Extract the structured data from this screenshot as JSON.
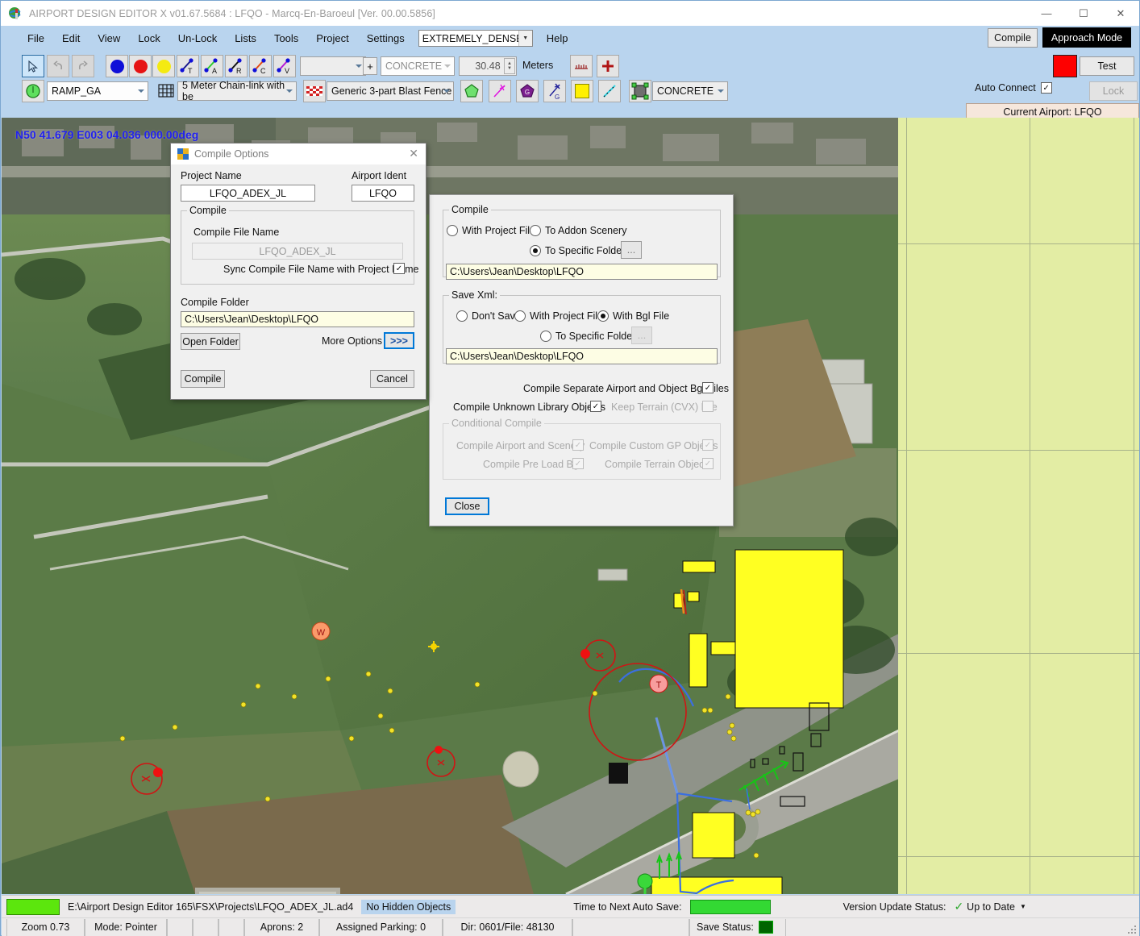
{
  "window": {
    "title": "AIRPORT DESIGN EDITOR X  v01.67.5684 : LFQO - Marcq-En-Baroeul [Ver. 00.00.5856]",
    "minimize": "—",
    "maximize": "☐",
    "close": "✕"
  },
  "menu": {
    "items": [
      "File",
      "Edit",
      "View",
      "Lock",
      "Un-Lock",
      "Lists",
      "Tools",
      "Project",
      "Settings"
    ],
    "density_value": "EXTREMELY_DENSE",
    "help": "Help",
    "compile_button": "Compile",
    "approach_mode_button": "Approach Mode"
  },
  "toolbar": {
    "pointer_icon": "pointer-icon",
    "undo_icon": "undo-icon",
    "redo_icon": "redo-icon",
    "blue_dot_icon": "blue-node-icon",
    "red_dot_icon": "red-node-icon",
    "yellow_dot_icon": "yellow-node-icon",
    "link_t_icon": "link-taxiway-icon",
    "link_a_icon": "link-apron-icon",
    "link_r_icon": "link-runway-icon",
    "link_c_icon": "link-closed-icon",
    "link_v_icon": "link-vehicle-icon",
    "empty_combo_value": "",
    "plus_label": "+",
    "surface_combo_value": "CONCRETE",
    "width_value": "30.48",
    "units_label": "Meters",
    "ruler_icon": "ruler-icon",
    "crosshair_icon": "red-cross-icon",
    "parking_icon": "parking-circle-icon",
    "parking_combo_value": "RAMP_GA",
    "fence_grid_icon": "fence-grid-icon",
    "fence_combo_value": "5 Meter Chain-link with be",
    "blast_icon": "blast-fence-icon",
    "blast_combo_value": "Generic 3-part Blast Fence",
    "polygon_icon": "green-polygon-icon",
    "magenta_line_icon": "magenta-vector-icon",
    "gp_icon": "purple-gp-icon",
    "g_vector_icon": "g-vector-icon",
    "yellow_square_icon": "yellow-square-icon",
    "dashed_line_icon": "dashed-line-icon",
    "select_box_icon": "select-box-icon",
    "material_combo_value": "CONCRETE",
    "auto_connect_label": "Auto Connect",
    "auto_connect_checked": true,
    "color_swatch": "#fe0000",
    "test_button": "Test",
    "lock_button": "Lock",
    "current_airport": "Current Airport: LFQO"
  },
  "map": {
    "coordinates": "N50 41.679   E003 04.036 000.00deg",
    "wind_marker": "W",
    "tower_marker": "T",
    "grid_panel_color": "#e3eda4"
  },
  "compile_dialog": {
    "title": "Compile Options",
    "close_icon": "close-icon",
    "project_name_label": "Project Name",
    "project_name_value": "LFQO_ADEX_JL",
    "airport_ident_label": "Airport Ident",
    "airport_ident_value": "LFQO",
    "compile_group_title": "Compile",
    "compile_file_name_label": "Compile File Name",
    "compile_file_name_value": "LFQO_ADEX_JL",
    "sync_label": "Sync Compile File Name with Project Name",
    "sync_checked": true,
    "compile_folder_label": "Compile Folder",
    "compile_folder_value": "C:\\Users\\Jean\\Desktop\\LFQO",
    "open_folder_button": "Open Folder",
    "more_options_label": "More Options",
    "more_options_button": ">>>",
    "compile_button": "Compile",
    "cancel_button": "Cancel"
  },
  "options_panel": {
    "compile_group_title": "Compile",
    "compile_options": [
      {
        "label": "With Project File",
        "selected": false
      },
      {
        "label": "To Addon Scenery",
        "selected": false
      },
      {
        "label": "To Specific Folder",
        "selected": true
      }
    ],
    "compile_browse_button": "...",
    "compile_path_value": "C:\\Users\\Jean\\Desktop\\LFQO",
    "savexml_group_title": "Save Xml:",
    "savexml_options": [
      {
        "label": "Don't Save",
        "selected": false
      },
      {
        "label": "With Project File",
        "selected": false
      },
      {
        "label": "With Bgl File",
        "selected": true
      },
      {
        "label": "To Specific Folder",
        "selected": false
      }
    ],
    "savexml_browse_button": "...",
    "savexml_path_value": "C:\\Users\\Jean\\Desktop\\LFQO",
    "separate_bgl_label": "Compile Separate Airport and Object Bgl Files",
    "separate_bgl_checked": true,
    "unknown_lib_label": "Compile Unknown Library Objects",
    "unknown_lib_checked": true,
    "keep_terrain_label": "Keep Terrain (CVX) File",
    "keep_terrain_checked": false,
    "keep_terrain_disabled": true,
    "conditional_group_title": "Conditional Compile",
    "conditional_items": [
      {
        "label": "Compile Airport and Scenery",
        "checked": true
      },
      {
        "label": "Compile Custom GP Objects",
        "checked": true
      },
      {
        "label": "Compile Pre Load Bgl",
        "checked": true
      },
      {
        "label": "Compile Terrain Objects",
        "checked": true
      }
    ],
    "close_button": "Close"
  },
  "statusbar_top": {
    "progress_color": "#5ce60d",
    "project_path": "E:\\Airport Design Editor 165\\FSX\\Projects\\LFQO_ADEX_JL.ad4",
    "hidden_objects": "No Hidden Objects",
    "autosave_label": "Time to Next Auto Save:",
    "autosave_color": "#33d933",
    "version_label": "Version Update Status:",
    "version_status": "Up to Date",
    "version_icon": "check-icon",
    "version_dropdown_icon": "chevron-down-icon"
  },
  "statusbar_bottom": {
    "zoom": "Zoom 0.73",
    "mode": "Mode: Pointer",
    "blank1": "",
    "blank2": "",
    "blank3": "",
    "aprons": "Aprons: 2",
    "assigned_parking": "Assigned Parking: 0",
    "dir_file": "Dir: 0601/File: 48130",
    "blank4": "",
    "save_status_label": "Save Status:",
    "save_status_color": "#006400"
  }
}
